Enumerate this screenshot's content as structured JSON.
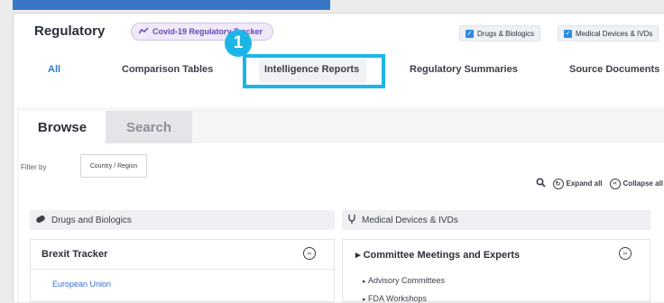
{
  "brand": "Regulatory",
  "tracker_pill": "Covid-19 Regulatory Tracker",
  "step_badge": "1",
  "checkboxes": [
    {
      "label": "Drugs & Biologics",
      "checked": true
    },
    {
      "label": "Medical Devices & IVDs",
      "checked": true
    }
  ],
  "nav_tabs": [
    "All",
    "Comparison Tables",
    "Intelligence Reports",
    "Regulatory Summaries",
    "Source Documents"
  ],
  "content_tabs": {
    "browse": "Browse",
    "search": "Search"
  },
  "filter": {
    "label": "Filter by",
    "button": "Country / Region"
  },
  "tools": {
    "expand": "Expand all",
    "collapse": "Collapse all"
  },
  "columns": {
    "left": {
      "header": "Drugs and Biologics",
      "card_title": "Brexit Tracker",
      "card_link": "European Union"
    },
    "right": {
      "header": "Medical Devices & IVDs",
      "card_title": "Committee Meetings and Experts",
      "sub_items": [
        "Advisory Committees",
        "FDA Workshops"
      ]
    }
  },
  "colors": {
    "accent": "#1cb6e6",
    "link": "#3b6fd0",
    "checkbox": "#2f8be0"
  }
}
